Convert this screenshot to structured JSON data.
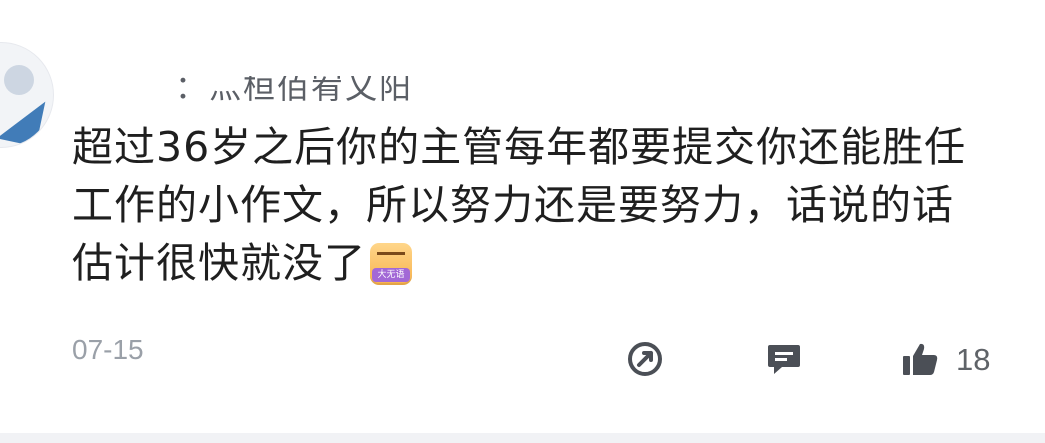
{
  "comment": {
    "username": "：灬桓佰宥乂阳",
    "text": "超过36岁之后你的主管每年都要提交你还能胜任工作的小作文，所以努力还是要努力，话说的话估计很快就没了",
    "emoji_label": "大无语",
    "date": "07-15",
    "like_count": "18"
  },
  "icons": {
    "share": "share-icon",
    "reply": "reply-icon",
    "like": "thumbs-up-icon"
  },
  "colors": {
    "text": "#1f1f1f",
    "muted": "#9aa0a8",
    "icon": "#4b4f56",
    "emoji_tag": "#a268d6"
  }
}
